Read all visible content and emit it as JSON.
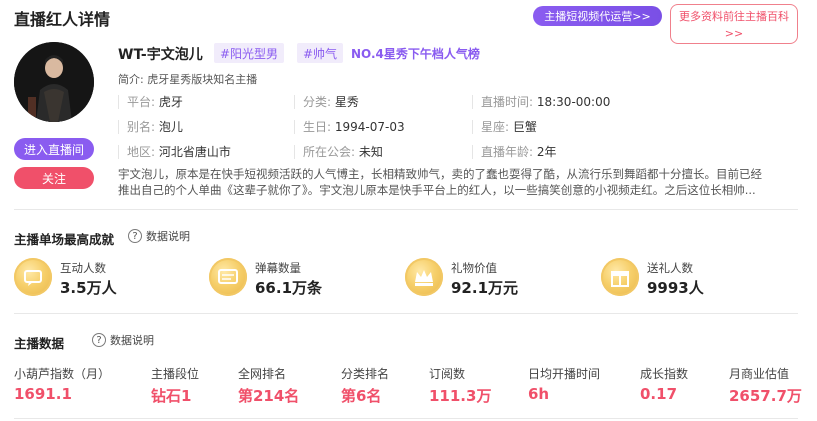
{
  "page": {
    "title": "直播红人详情"
  },
  "header": {
    "promo_label": "主播短视频代运营>>",
    "more_label_line1": "更多资料前往主播百科",
    "more_label_line2": ">>"
  },
  "profile": {
    "name": "WT-宇文泡儿",
    "tags": [
      "#阳光型男",
      "#帅气"
    ],
    "rank_text": "NO.4星秀下午档人气榜",
    "intro": "简介: 虎牙星秀版块知名主播",
    "enter_label": "进入直播间",
    "follow_label": "关注",
    "info": [
      {
        "k": "平台: ",
        "v": "虎牙"
      },
      {
        "k": "分类: ",
        "v": "星秀"
      },
      {
        "k": "直播时间: ",
        "v": "18:30-00:00"
      },
      {
        "k": "别名: ",
        "v": "泡儿"
      },
      {
        "k": "生日: ",
        "v": "1994-07-03"
      },
      {
        "k": "星座: ",
        "v": "巨蟹"
      },
      {
        "k": "地区: ",
        "v": "河北省唐山市"
      },
      {
        "k": "所在公会: ",
        "v": "未知"
      },
      {
        "k": "直播年龄: ",
        "v": "2年"
      }
    ],
    "desc_line1": "宇文泡儿，原本是在快手短视频活跃的人气博主，长相精致帅气，卖的了蠢也耍得了酷，从流行乐到舞蹈都十分擅长。目前已经",
    "desc_line2": "推出自己的个人单曲《这辈子就你了》。宇文泡儿原本是快手平台上的红人，以一些搞笑创意的小视频走红。之后这位长相帅..."
  },
  "achievements": {
    "title": "主播单场最高成就",
    "help": "数据说明",
    "items": [
      {
        "label": "互动人数",
        "value": "3.5万人",
        "icon": "interaction-coin-icon"
      },
      {
        "label": "弹幕数量",
        "value": "66.1万条",
        "icon": "danmaku-coin-icon"
      },
      {
        "label": "礼物价值",
        "value": "92.1万元",
        "icon": "gift-crown-coin-icon"
      },
      {
        "label": "送礼人数",
        "value": "9993人",
        "icon": "gift-giver-coin-icon"
      }
    ]
  },
  "stats": {
    "title": "主播数据",
    "help": "数据说明",
    "items": [
      {
        "label": "小葫芦指数（月）",
        "value": "1691.1"
      },
      {
        "label": "主播段位",
        "value": "钻石1"
      },
      {
        "label": "全网排名",
        "value": "第214名"
      },
      {
        "label": "分类排名",
        "value": "第6名"
      },
      {
        "label": "订阅数",
        "value": "111.3万"
      },
      {
        "label": "日均开播时间",
        "value": "6h"
      },
      {
        "label": "成长指数",
        "value": "0.17"
      },
      {
        "label": "月商业估值",
        "value": "2657.7万"
      }
    ]
  },
  "colors": {
    "accent_purple": "#8a5cf0",
    "accent_red": "#f0506a",
    "coin_gold": "#f6cf6a"
  }
}
